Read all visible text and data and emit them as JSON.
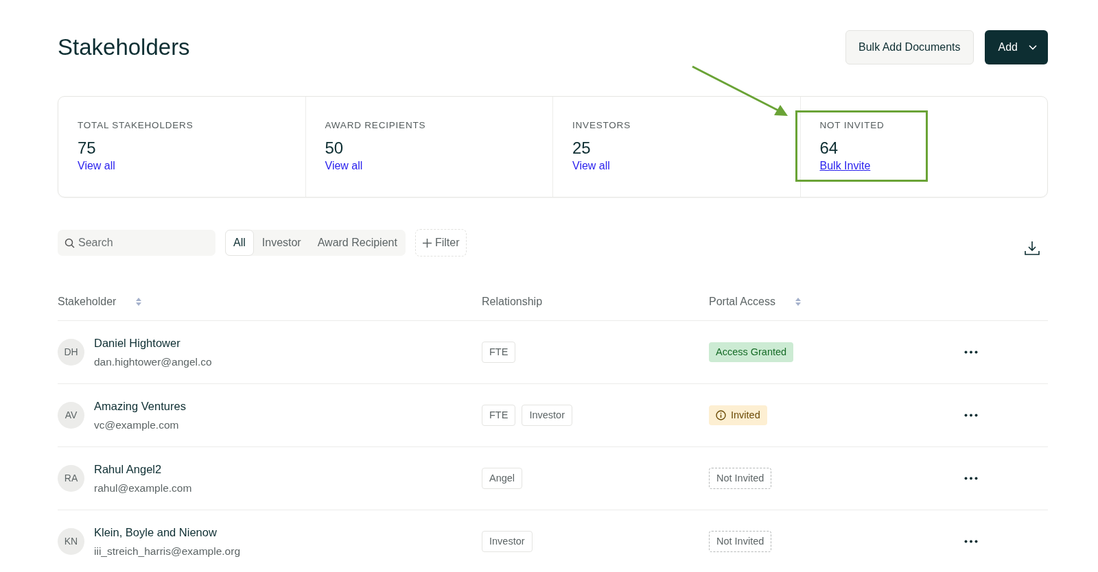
{
  "page": {
    "title": "Stakeholders"
  },
  "header_buttons": {
    "secondary": "Bulk Add Documents",
    "primary": "Add"
  },
  "stats": [
    {
      "label": "TOTAL STAKEHOLDERS",
      "value": "75",
      "link": "View all",
      "underlined": false,
      "highlighted": false
    },
    {
      "label": "AWARD RECIPIENTS",
      "value": "50",
      "link": "View all",
      "underlined": false,
      "highlighted": false
    },
    {
      "label": "INVESTORS",
      "value": "25",
      "link": "View all",
      "underlined": false,
      "highlighted": false
    },
    {
      "label": "NOT INVITED",
      "value": "64",
      "link": "Bulk Invite",
      "underlined": true,
      "highlighted": true
    }
  ],
  "search": {
    "placeholder": "Search"
  },
  "tabs": [
    {
      "label": "All",
      "selected": true
    },
    {
      "label": "Investor",
      "selected": false
    },
    {
      "label": "Award Recipient",
      "selected": false
    }
  ],
  "filter_button": "Filter",
  "table": {
    "columns": [
      {
        "label": "Stakeholder",
        "sortable": true
      },
      {
        "label": "Relationship",
        "sortable": false
      },
      {
        "label": "Portal Access",
        "sortable": true
      }
    ],
    "rows": [
      {
        "initials": "DH",
        "name": "Daniel Hightower",
        "email": "dan.hightower@angel.co",
        "relationships": [
          "FTE"
        ],
        "access": {
          "kind": "granted",
          "label": "Access Granted"
        }
      },
      {
        "initials": "AV",
        "name": "Amazing Ventures",
        "email": "vc@example.com",
        "relationships": [
          "FTE",
          "Investor"
        ],
        "access": {
          "kind": "invited",
          "label": "Invited"
        }
      },
      {
        "initials": "RA",
        "name": "Rahul Angel2",
        "email": "rahul@example.com",
        "relationships": [
          "Angel"
        ],
        "access": {
          "kind": "not_invited",
          "label": "Not Invited"
        }
      },
      {
        "initials": "KN",
        "name": "Klein, Boyle and Nienow",
        "email": "iii_streich_harris@example.org",
        "relationships": [
          "Investor"
        ],
        "access": {
          "kind": "not_invited",
          "label": "Not Invited"
        }
      }
    ]
  }
}
